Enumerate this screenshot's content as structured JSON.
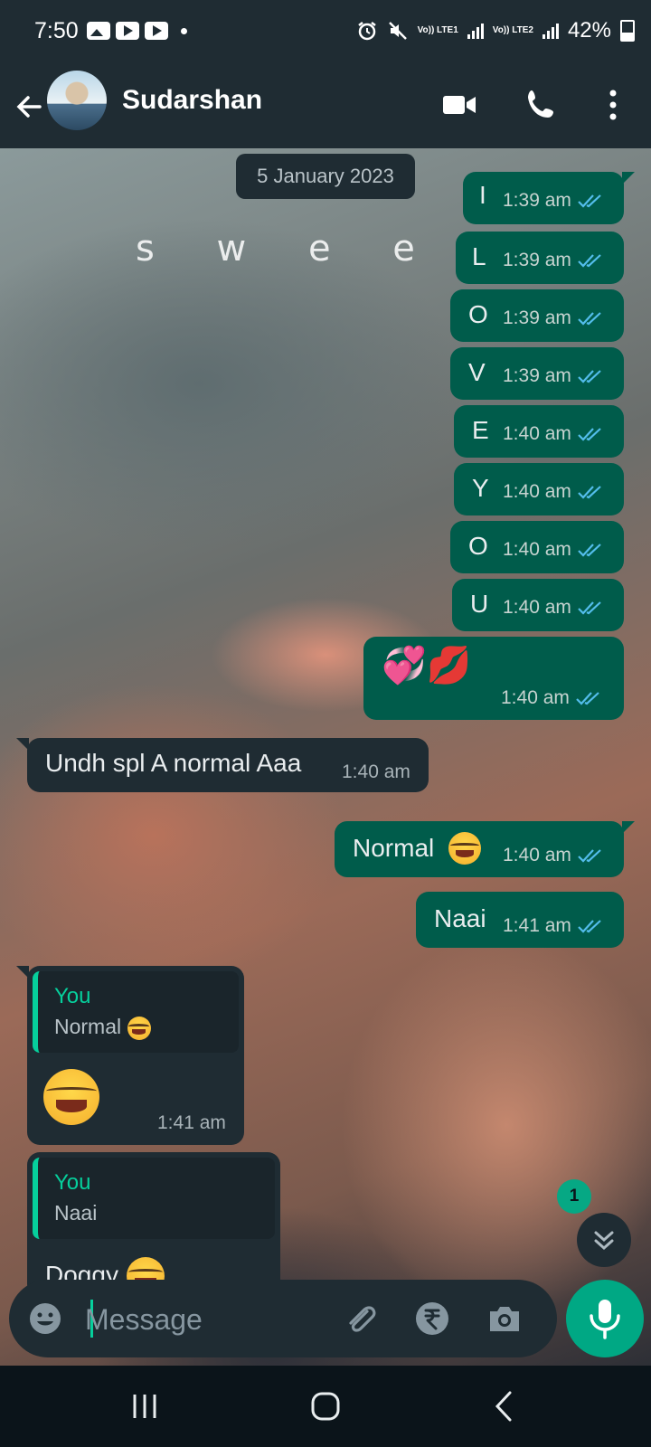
{
  "status_bar": {
    "time": "7:50",
    "battery": "42%",
    "sim1": "Vo)) LTE1",
    "sim2": "Vo)) LTE2",
    "icons": [
      "gallery-icon",
      "youtube-icon",
      "youtube-icon",
      "dot-icon",
      "alarm-icon",
      "mute-icon",
      "signal-icon",
      "signal-icon",
      "battery-icon"
    ]
  },
  "header": {
    "contact_name": "Sudarshan",
    "icons": [
      "back-arrow-icon",
      "avatar",
      "video-call-icon",
      "phone-icon",
      "more-options-icon"
    ]
  },
  "chat": {
    "date_chip": "5 January 2023",
    "wallpaper_text": "s w e e t i",
    "messages": [
      {
        "dir": "out",
        "text": "I",
        "time": "1:39 am",
        "status": "read"
      },
      {
        "dir": "out",
        "text": "L",
        "time": "1:39 am",
        "status": "read"
      },
      {
        "dir": "out",
        "text": "O",
        "time": "1:39 am",
        "status": "read"
      },
      {
        "dir": "out",
        "text": "V",
        "time": "1:39 am",
        "status": "read"
      },
      {
        "dir": "out",
        "text": "E",
        "time": "1:40 am",
        "status": "read"
      },
      {
        "dir": "out",
        "text": "Y",
        "time": "1:40 am",
        "status": "read"
      },
      {
        "dir": "out",
        "text": "O",
        "time": "1:40 am",
        "status": "read"
      },
      {
        "dir": "out",
        "text": "U",
        "time": "1:40 am",
        "status": "read"
      },
      {
        "dir": "out",
        "text": "💞💋",
        "time": "1:40 am",
        "status": "read"
      },
      {
        "dir": "in",
        "text": "Undh spl A normal Aaa",
        "time": "1:40 am"
      },
      {
        "dir": "out",
        "text": "Normal",
        "emoji": "face-with-tears-of-joy",
        "time": "1:40 am",
        "status": "read"
      },
      {
        "dir": "out",
        "text": "Naai",
        "time": "1:41 am",
        "status": "read"
      },
      {
        "dir": "in",
        "quote_author": "You",
        "quote_text": "Normal",
        "quote_emoji": "face-with-tears-of-joy",
        "emoji": "face-with-tears-of-joy",
        "time": "1:41 am"
      },
      {
        "dir": "in",
        "quote_author": "You",
        "quote_text": "Naai",
        "text": "Doggy",
        "emoji": "face-with-tears-of-joy"
      }
    ],
    "unread_count": "1"
  },
  "composer": {
    "placeholder": "Message",
    "icons": [
      "emoji-icon",
      "attach-icon",
      "rupee-payment-icon",
      "camera-icon",
      "mic-icon"
    ]
  },
  "colors": {
    "header_bg": "#1f2c33",
    "outgoing_bubble": "#005c4b",
    "incoming_bubble": "#1f2c33",
    "accent": "#00a884",
    "read_ticks": "#53bdeb"
  }
}
